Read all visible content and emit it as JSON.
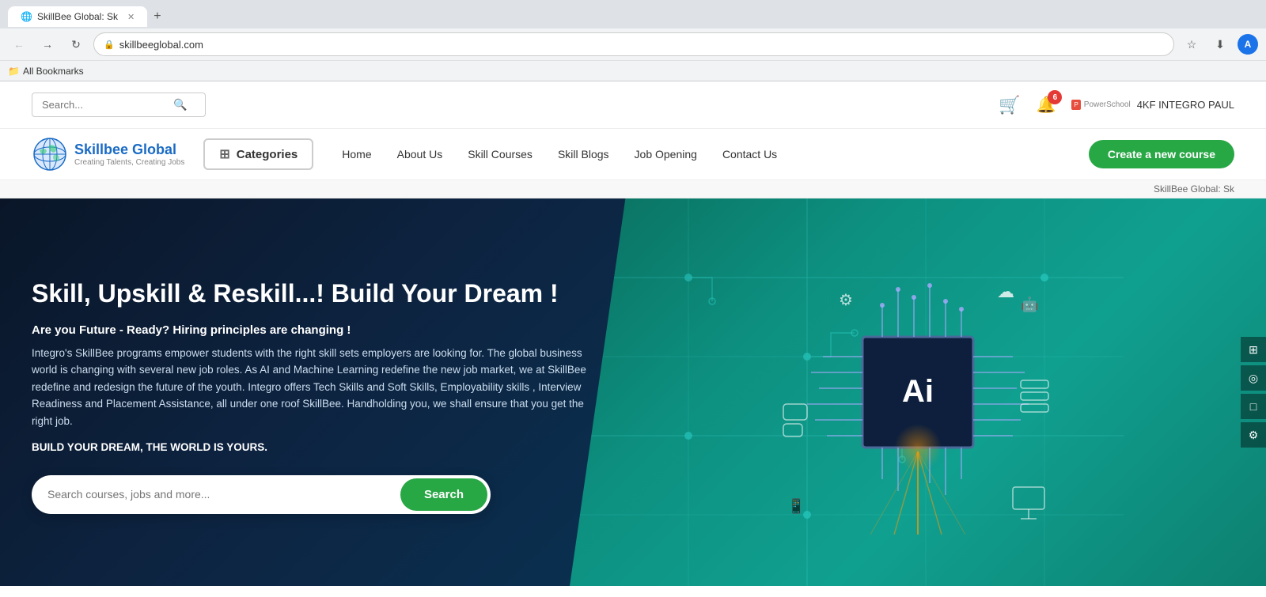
{
  "browser": {
    "tab_title": "SkillBee Global: Sk",
    "url": "skillbeeglobal.com",
    "back_btn": "←",
    "forward_btn": "→",
    "reload_btn": "↺",
    "star_label": "★",
    "download_label": "⬇",
    "profile_letter": "A",
    "bookmarks_label": "All Bookmarks"
  },
  "header": {
    "search_placeholder": "Search...",
    "cart_badge": "",
    "notification_count": "6",
    "powerschool_text": "PowerSchool",
    "user_label": "4KF INTEGRO PAUL"
  },
  "nav": {
    "logo_title": "Skillbee Global",
    "logo_subtitle": "Creating Talents, Creating Jobs",
    "categories_label": "Categories",
    "links": [
      {
        "label": "Home",
        "id": "home"
      },
      {
        "label": "About Us",
        "id": "about"
      },
      {
        "label": "Skill Courses",
        "id": "courses"
      },
      {
        "label": "Skill Blogs",
        "id": "blogs"
      },
      {
        "label": "Job Opening",
        "id": "jobs"
      },
      {
        "label": "Contact Us",
        "id": "contact"
      }
    ],
    "cta_label": "Create a new course"
  },
  "breadcrumb": {
    "text": "SkillBee Global: Sk"
  },
  "hero": {
    "title": "Skill, Upskill & Reskill...! Build Your Dream !",
    "subtitle": "Are you Future - Ready? Hiring principles are changing !",
    "body": "Integro's SkillBee programs empower students with the right skill sets employers are looking for. The global business world is changing with several new job roles. As AI and Machine Learning redefine the new job market, we at SkillBee redefine and redesign the future of the youth. Integro offers Tech Skills and Soft Skills, Employability skills , Interview Readiness and Placement Assistance, all under one roof SkillBee. Handholding you, we shall ensure that you get the right job.",
    "cta_text": "BUILD YOUR DREAM, THE WORLD IS YOURS.",
    "search_placeholder": "Search courses, jobs and more...",
    "search_btn_label": "Search",
    "ai_chip_label": "Ai"
  }
}
